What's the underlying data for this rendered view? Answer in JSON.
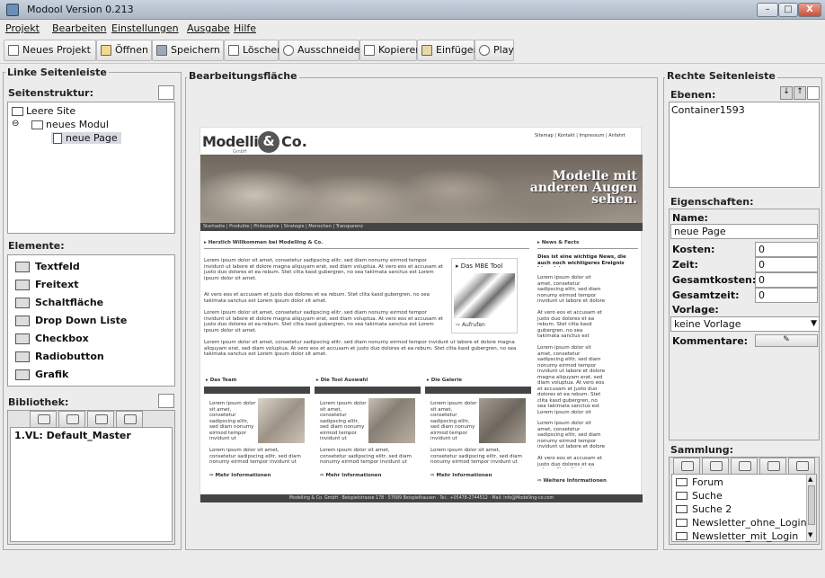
{
  "window": {
    "title": "Modool Version 0.213",
    "min": "–",
    "max": "□",
    "close": "X"
  },
  "menu": [
    "Projekt",
    "Bearbeiten",
    "Einstellungen",
    "Ausgabe",
    "Hilfe"
  ],
  "toolbar": [
    "Neues Projekt",
    "Öffnen",
    "Speichern",
    "Löschen",
    "Ausschneiden",
    "Kopieren",
    "Einfügen",
    "Play"
  ],
  "left": {
    "legend": "Linke Seitenleiste",
    "structure_title": "Seitenstruktur:",
    "tree": [
      "Leere Site",
      "neues Modul",
      "neue Page"
    ],
    "elements_title": "Elemente:",
    "elements": [
      {
        "label": "Textfeld",
        "icon": "textfield-icon"
      },
      {
        "label": "Freitext",
        "icon": "freetext-icon"
      },
      {
        "label": "Schaltfläche",
        "icon": "button-icon"
      },
      {
        "label": "Drop Down Liste",
        "icon": "dropdown-icon"
      },
      {
        "label": "Checkbox",
        "icon": "checkbox-icon"
      },
      {
        "label": "Radiobutton",
        "icon": "radiobutton-icon"
      },
      {
        "label": "Grafik",
        "icon": "image-icon"
      }
    ],
    "library_title": "Bibliothek:",
    "library_items": [
      "1.VL: Default_Master"
    ]
  },
  "center": {
    "legend": "Bearbeitungsfläche",
    "site": {
      "logo": "Modelling",
      "logo_co": "Co.",
      "logo_sub": "GmbH",
      "toplinks": "Sitemap | Kontakt | Impressum | Anfahrt",
      "banner_text": [
        "Modelle mit",
        "anderen Augen",
        "sehen."
      ],
      "nav": "Startseite | Produkte | Philosophie | Strategie | Menschen | Transparenz",
      "welcome": "Herzlich Willkommen bei Modelling & Co.",
      "lorem": "Lorem ipsum dolor sit amet, consetetur sadipscing elitr, sed diam nonumy eirmod tempor invidunt ut labore et dolore magna aliquyam erat, sed diam voluptua. At vero eos et accusam et justo duo dolores et ea rebum. Stet clita kasd gubergren, no sea takimata sanctus est Lorem ipsum dolor sit amet.",
      "lorem2": "At vero eos et accusam et justo duo dolores et ea rebum. Stet clita kasd gubergren, no sea takimata sanctus est Lorem ipsum dolor sit amet.",
      "tool_box_title": "Das MBE Tool",
      "tool_box_link": "Aufrufen",
      "news_title": "News & Facts",
      "news_bold": "Dies ist eine wichtige News, die auch noch wichtigeres Ereignis hinweist.",
      "news_link": "Weitere Informationen",
      "cards": [
        {
          "title": "Das Team",
          "more": "Mehr Informationen"
        },
        {
          "title": "Die Tool Auswahl",
          "more": "Mehr Informationen"
        },
        {
          "title": "Die Galerie",
          "more": "Mehr Informationen"
        }
      ],
      "card_text": "Lorem ipsum dolor sit amet, consetetur sadipscing elitr, sed diam nonumy eirmod tempor invidunt ut",
      "card_text2": "Lorem ipsum dolor sit amet, consetetur sadipscing elitr, sed diam nonumy eirmod tempor invidunt ut labore",
      "footer": "Modelling & Co. GmbH · Beispielstrasse 178 · 57689 Beispielhausen · Tel.: +05478-2744512 · Mail: info@Modelling-co.com"
    }
  },
  "right": {
    "legend": "Rechte Seitenleiste",
    "layers_title": "Ebenen:",
    "layers": [
      "Container1593"
    ],
    "props_title": "Eigenschaften:",
    "name_label": "Name:",
    "name_value": "neue Page",
    "fields": [
      {
        "label": "Kosten:",
        "value": "0"
      },
      {
        "label": "Zeit:",
        "value": "0"
      },
      {
        "label": "Gesamtkosten:",
        "value": "0"
      },
      {
        "label": "Gesamtzeit:",
        "value": "0"
      }
    ],
    "template_label": "Vorlage:",
    "template_value": "keine Vorlage",
    "comments_label": "Kommentare:",
    "collection_title": "Sammlung:",
    "collection": [
      "Forum",
      "Suche",
      "Suche 2",
      "Newsletter_ohne_Login",
      "Newsletter_mit_Login"
    ]
  }
}
